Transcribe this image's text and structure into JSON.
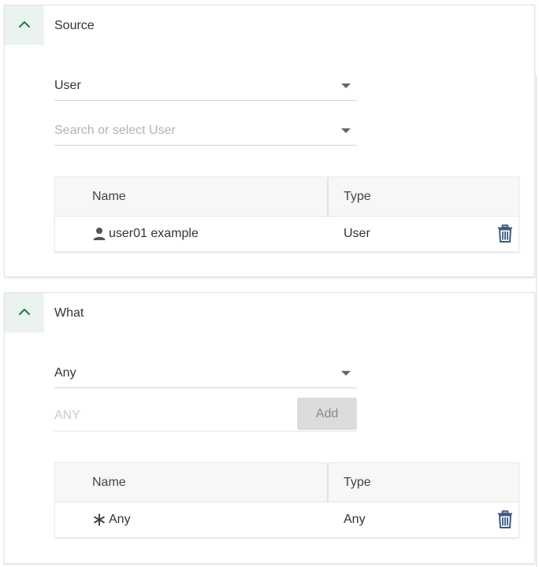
{
  "source": {
    "title": "Source",
    "type_select": {
      "value": "User"
    },
    "search_select": {
      "placeholder": "Search or select User"
    },
    "table": {
      "columns": [
        "Name",
        "Type"
      ],
      "rows": [
        {
          "icon": "user-icon",
          "name": "user01 example",
          "type": "User"
        }
      ]
    }
  },
  "what": {
    "title": "What",
    "type_select": {
      "value": "Any"
    },
    "value_input": {
      "placeholder": "ANY",
      "value": ""
    },
    "add_label": "Add",
    "table": {
      "columns": [
        "Name",
        "Type"
      ],
      "rows": [
        {
          "icon": "asterisk-icon",
          "name": "Any",
          "type": "Any"
        }
      ]
    }
  },
  "colors": {
    "accent": "#1f7a4d",
    "header_tint": "#eaf3ee",
    "delete_icon": "#3d5a80"
  }
}
